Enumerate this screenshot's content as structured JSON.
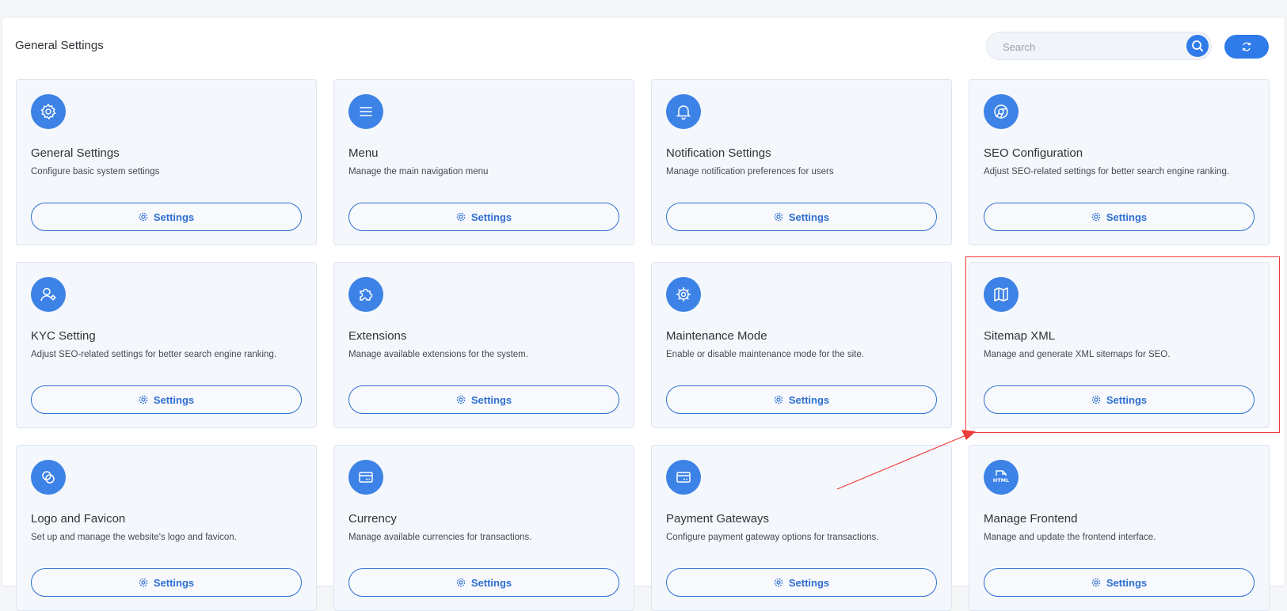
{
  "header": {
    "title": "General Settings",
    "search_placeholder": "Search",
    "search_icon": "search-icon",
    "refresh_icon": "refresh-icon"
  },
  "colors": {
    "accent": "#2f7bea",
    "card_bg": "#f4f7fc",
    "highlight": "#ee3b3b"
  },
  "cards": [
    {
      "icon": "gear-icon",
      "title": "General Settings",
      "desc": "Configure basic system settings",
      "button": "Settings"
    },
    {
      "icon": "menu-icon",
      "title": "Menu",
      "desc": "Manage the main navigation menu",
      "button": "Settings"
    },
    {
      "icon": "bell-icon",
      "title": "Notification Settings",
      "desc": "Manage notification preferences for users",
      "button": "Settings"
    },
    {
      "icon": "chrome-icon",
      "title": "SEO Configuration",
      "desc": "Adjust SEO-related settings for better search engine ranking.",
      "button": "Settings"
    },
    {
      "icon": "user-gear-icon",
      "title": "KYC Setting",
      "desc": "Adjust SEO-related settings for better search engine ranking.",
      "button": "Settings"
    },
    {
      "icon": "puzzle-icon",
      "title": "Extensions",
      "desc": "Manage available extensions for the system.",
      "button": "Settings"
    },
    {
      "icon": "cog-icon",
      "title": "Maintenance Mode",
      "desc": "Enable or disable maintenance mode for the site.",
      "button": "Settings"
    },
    {
      "icon": "map-icon",
      "title": "Sitemap XML",
      "desc": "Manage and generate XML sitemaps for SEO.",
      "button": "Settings"
    },
    {
      "icon": "circles-icon",
      "title": "Logo and Favicon",
      "desc": "Set up and manage the website's logo and favicon.",
      "button": "Settings"
    },
    {
      "icon": "card-icon",
      "title": "Currency",
      "desc": "Manage available currencies for transactions.",
      "button": "Settings"
    },
    {
      "icon": "card-icon",
      "title": "Payment Gateways",
      "desc": "Configure payment gateway options for transactions.",
      "button": "Settings"
    },
    {
      "icon": "html-file-icon",
      "title": "Manage Frontend",
      "desc": "Manage and update the frontend interface.",
      "button": "Settings"
    }
  ],
  "annotation": {
    "highlighted_card": "Sitemap XML"
  }
}
